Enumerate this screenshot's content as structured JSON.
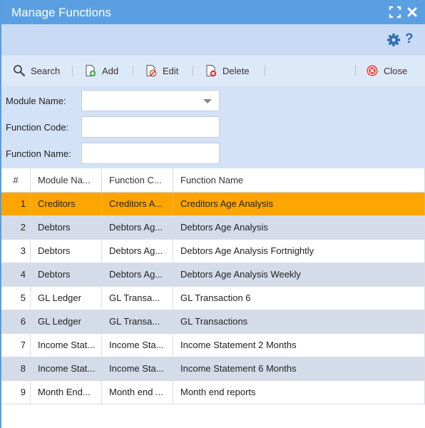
{
  "window": {
    "title": "Manage Functions"
  },
  "toolbar": {
    "search_label": "Search",
    "add_label": "Add",
    "edit_label": "Edit",
    "delete_label": "Delete",
    "close_label": "Close"
  },
  "subbar": {
    "help_label": "?"
  },
  "form": {
    "module_name_label": "Module Name:",
    "module_name_value": "",
    "function_code_label": "Function Code:",
    "function_code_value": "",
    "function_name_label": "Function Name:",
    "function_name_value": ""
  },
  "grid": {
    "columns": [
      "#",
      "Module Na...",
      "Function C...",
      "Function Name"
    ],
    "rows": [
      {
        "num": "1",
        "module": "Creditors",
        "code": "Creditors A...",
        "name": "Creditors Age Analysis",
        "selected": true
      },
      {
        "num": "2",
        "module": "Debtors",
        "code": "Debtors Ag...",
        "name": "Debtors Age Analysis"
      },
      {
        "num": "3",
        "module": "Debtors",
        "code": "Debtors Ag...",
        "name": "Debtors Age Analysis Fortnightly"
      },
      {
        "num": "4",
        "module": "Debtors",
        "code": "Debtors Ag...",
        "name": "Debtors Age Analysis Weekly"
      },
      {
        "num": "5",
        "module": "GL Ledger",
        "code": "GL Transa...",
        "name": "GL Transaction 6"
      },
      {
        "num": "6",
        "module": "GL Ledger",
        "code": "GL Transa...",
        "name": "GL Transactions"
      },
      {
        "num": "7",
        "module": "Income Stat...",
        "code": "Income Sta...",
        "name": "Income Statement 2 Months"
      },
      {
        "num": "8",
        "module": "Income Stat...",
        "code": "Income Sta...",
        "name": "Income Statement 6 Months"
      },
      {
        "num": "9",
        "module": "Month End...",
        "code": "Month end ...",
        "name": "Month end reports"
      }
    ]
  },
  "colors": {
    "titlebar": "#5b9fe3",
    "selected_row": "#ffa500",
    "alt_row": "#d4dcea"
  }
}
